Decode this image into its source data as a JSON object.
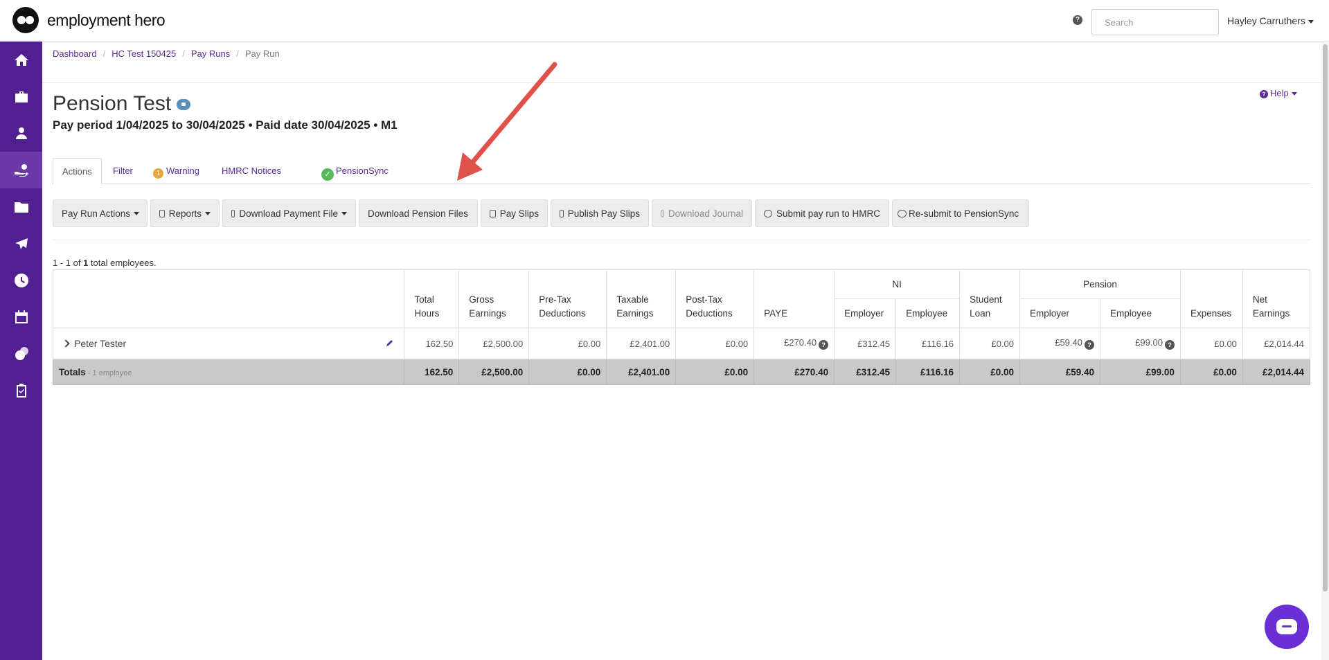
{
  "app": {
    "logo_text": "employment hero"
  },
  "header": {
    "search_placeholder": "Search",
    "user_name": "Hayley Carruthers"
  },
  "sidebar": {
    "items": [
      {
        "icon": "home-icon"
      },
      {
        "icon": "briefcase-icon"
      },
      {
        "icon": "people-icon"
      },
      {
        "icon": "payroll-hand-icon",
        "active": true
      },
      {
        "icon": "folder-icon"
      },
      {
        "icon": "plane-icon"
      },
      {
        "icon": "clock-icon"
      },
      {
        "icon": "calendar-icon"
      },
      {
        "icon": "coins-icon"
      },
      {
        "icon": "clipboard-icon"
      }
    ]
  },
  "breadcrumb": {
    "items": [
      "Dashboard",
      "HC Test 150425",
      "Pay Runs"
    ],
    "current": "Pay Run"
  },
  "help_label": "Help",
  "page": {
    "title": "Pension Test",
    "subtitle": "Pay period 1/04/2025 to 30/04/2025 • Paid date 30/04/2025 • M1"
  },
  "tabs": {
    "actions": "Actions",
    "filter": "Filter",
    "warning_count": "1",
    "warning": "Warning",
    "hmrc": "HMRC Notices",
    "pensionsync": "PensionSync"
  },
  "toolbar": {
    "pay_run_actions": "Pay Run Actions",
    "reports": "Reports",
    "download_payment_file": "Download Payment File",
    "download_pension_files": "Download Pension Files",
    "pay_slips": "Pay Slips",
    "publish_pay_slips": "Publish Pay Slips",
    "download_journal": "Download Journal",
    "submit_hmrc": "Submit pay run to HMRC",
    "resubmit_pensionsync": "Re-submit to PensionSync"
  },
  "count": {
    "prefix": "1 - 1 of ",
    "total": "1",
    "suffix": " total employees."
  },
  "table": {
    "headers": {
      "total_hours": "Total Hours",
      "gross_earnings": "Gross Earnings",
      "pre_tax": "Pre-Tax Deductions",
      "taxable": "Taxable Earnings",
      "post_tax": "Post-Tax Deductions",
      "paye": "PAYE",
      "ni": "NI",
      "ni_employer": "Employer",
      "ni_employee": "Employee",
      "student_loan": "Student Loan",
      "pension": "Pension",
      "pension_employer": "Employer",
      "pension_employee": "Employee",
      "expenses": "Expenses",
      "net_earnings": "Net Earnings"
    },
    "row": {
      "name": "Peter Tester",
      "total_hours": "162.50",
      "gross_earnings": "£2,500.00",
      "pre_tax": "£0.00",
      "taxable": "£2,401.00",
      "post_tax": "£0.00",
      "paye": "£270.40",
      "ni_employer": "£312.45",
      "ni_employee": "£116.16",
      "student_loan": "£0.00",
      "pension_employer": "£59.40",
      "pension_employee": "£99.00",
      "expenses": "£0.00",
      "net_earnings": "£2,014.44"
    },
    "totals": {
      "label": "Totals",
      "sub": " - 1 employee",
      "total_hours": "162.50",
      "gross_earnings": "£2,500.00",
      "pre_tax": "£0.00",
      "taxable": "£2,401.00",
      "post_tax": "£0.00",
      "paye": "£270.40",
      "ni_employer": "£312.45",
      "ni_employee": "£116.16",
      "student_loan": "£0.00",
      "pension_employer": "£59.40",
      "pension_employee": "£99.00",
      "expenses": "£0.00",
      "net_earnings": "£2,014.44"
    }
  },
  "colors": {
    "brand": "#511f8f",
    "link": "#5a2a9a",
    "annotation_arrow": "#e0514a",
    "chat": "#6b2fd6"
  }
}
